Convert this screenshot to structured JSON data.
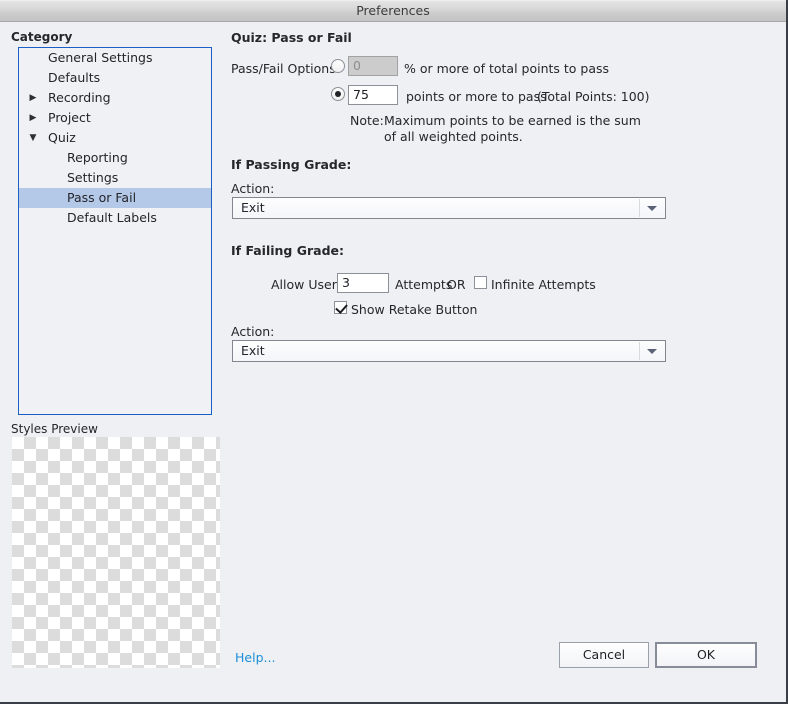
{
  "window": {
    "title": "Preferences"
  },
  "sidebar": {
    "heading": "Category",
    "items": [
      {
        "label": "General Settings",
        "twisty": "",
        "indent": 1,
        "selected": false
      },
      {
        "label": "Defaults",
        "twisty": "",
        "indent": 1,
        "selected": false
      },
      {
        "label": "Recording",
        "twisty": "collapsed-arrow",
        "indent": 1,
        "selected": false
      },
      {
        "label": "Project",
        "twisty": "collapsed-arrow",
        "indent": 1,
        "selected": false
      },
      {
        "label": "Quiz",
        "twisty": "expanded-arrow",
        "indent": 1,
        "selected": false
      },
      {
        "label": "Reporting",
        "twisty": "",
        "indent": 2,
        "selected": false
      },
      {
        "label": "Settings",
        "twisty": "",
        "indent": 2,
        "selected": false
      },
      {
        "label": "Pass or Fail",
        "twisty": "",
        "indent": 2,
        "selected": true
      },
      {
        "label": "Default Labels",
        "twisty": "",
        "indent": 2,
        "selected": false
      }
    ],
    "styles_preview_label": "Styles Preview"
  },
  "main": {
    "title": "Quiz: Pass or Fail",
    "passfail": {
      "label": "Pass/Fail Options:",
      "percent_option": {
        "selected": false,
        "value": "0",
        "suffix": "% or more of total points to pass"
      },
      "points_option": {
        "selected": true,
        "value": "75",
        "suffix": "points or more to pass",
        "total": "(Total Points: 100)"
      },
      "note_label": "Note:",
      "note_text": "Maximum points to be earned is the sum of all weighted points."
    },
    "passing": {
      "heading": "If Passing Grade:",
      "action_label": "Action:",
      "action_value": "Exit"
    },
    "failing": {
      "heading": "If Failing Grade:",
      "allow_user_label": "Allow User:",
      "attempts_value": "3",
      "attempts_label": "Attempts",
      "or_label": "OR",
      "infinite_attempts_label": "Infinite Attempts",
      "infinite_attempts_checked": false,
      "show_retake_label": "Show Retake Button",
      "show_retake_checked": true,
      "action_label": "Action:",
      "action_value": "Exit"
    }
  },
  "footer": {
    "help_label": "Help...",
    "cancel_label": "Cancel",
    "ok_label": "OK"
  },
  "colors": {
    "dialog_bg": "#eff0f4",
    "tree_focus_border": "#1a5fc4",
    "selection": "#b4c8e8",
    "link": "#1a8fd6"
  }
}
